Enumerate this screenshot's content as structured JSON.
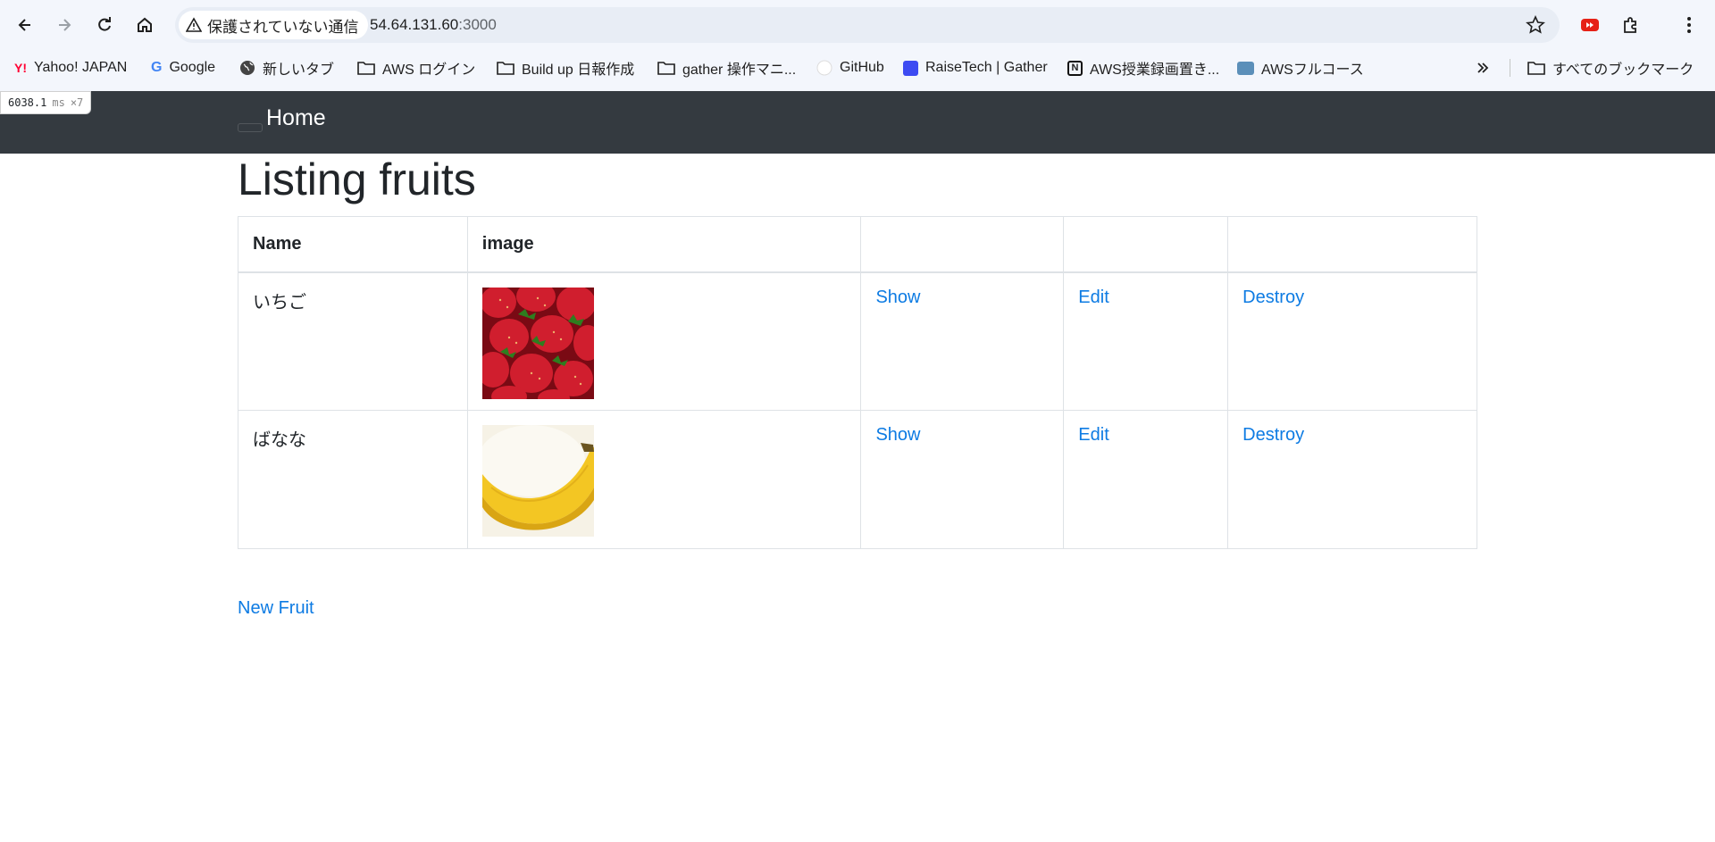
{
  "browser": {
    "security_label": "保護されていない通信",
    "url_host": "54.64.131.60",
    "url_port": ":3000",
    "bookmarks": [
      {
        "label": "Yahoo! JAPAN",
        "icon": "yahoo-icon"
      },
      {
        "label": "Google",
        "icon": "google-icon"
      },
      {
        "label": "新しいタブ",
        "icon": "globe-icon"
      },
      {
        "label": "AWS ログイン",
        "icon": "folder-icon"
      },
      {
        "label": "Build up 日報作成",
        "icon": "folder-icon"
      },
      {
        "label": "gather 操作マニ...",
        "icon": "folder-icon"
      },
      {
        "label": "GitHub",
        "icon": "github-icon"
      },
      {
        "label": "RaiseTech | Gather",
        "icon": "gather-icon"
      },
      {
        "label": "AWS授業録画置き...",
        "icon": "notion-icon"
      },
      {
        "label": "AWSフルコース",
        "icon": "aws-course-icon"
      }
    ],
    "all_bookmarks_label": "すべてのブックマーク"
  },
  "timing": {
    "value": "6038.1",
    "unit": "ms",
    "multiplier": "×7"
  },
  "navbar": {
    "brand": "Home"
  },
  "page": {
    "title": "Listing fruits",
    "table": {
      "headers": [
        "Name",
        "image",
        "",
        "",
        ""
      ],
      "rows": [
        {
          "name": "いちご",
          "image": "strawberry-image",
          "show": "Show",
          "edit": "Edit",
          "destroy": "Destroy"
        },
        {
          "name": "ばなな",
          "image": "banana-image",
          "show": "Show",
          "edit": "Edit",
          "destroy": "Destroy"
        }
      ]
    },
    "new_link": "New Fruit"
  },
  "colors": {
    "navbar_bg": "#343a40",
    "link": "#0d7be3",
    "chrome_bg": "#f3f6fc"
  }
}
